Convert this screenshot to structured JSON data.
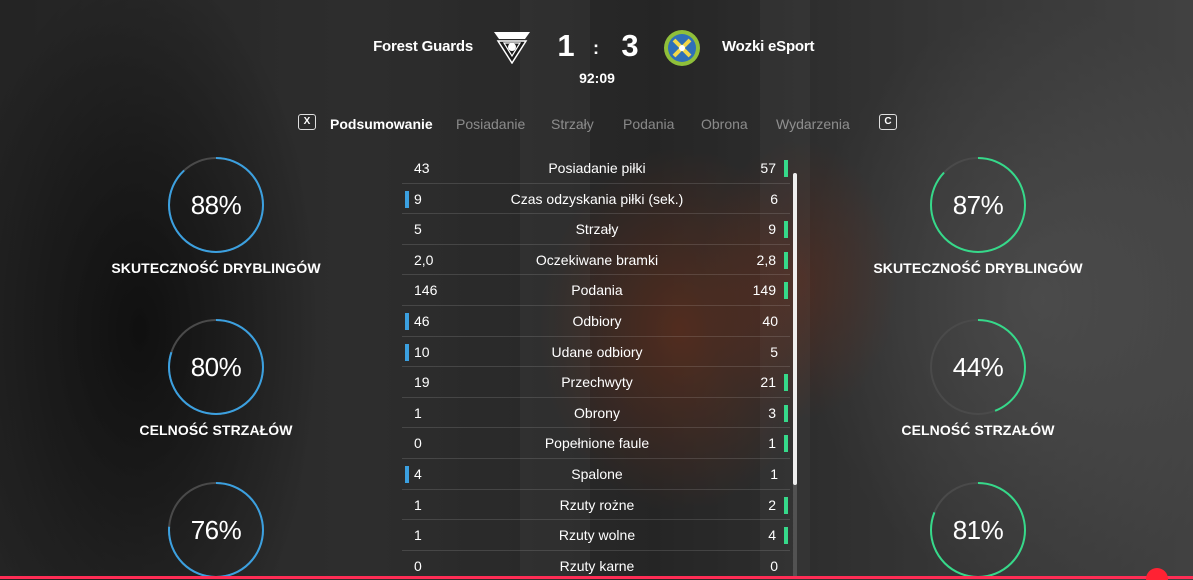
{
  "match": {
    "home_team": "Forest Guards",
    "away_team": "Wozki eSport",
    "home_score": "1",
    "separator": ":",
    "away_score": "3",
    "clock": "92:09",
    "home_crest_icon": "shield-wings-crest-icon",
    "away_crest_icon": "laurel-cross-crest-icon"
  },
  "tabs": {
    "prev_key": "X",
    "next_key": "C",
    "items": [
      {
        "label": "Podsumowanie",
        "active": true
      },
      {
        "label": "Posiadanie",
        "active": false
      },
      {
        "label": "Strzały",
        "active": false
      },
      {
        "label": "Podania",
        "active": false
      },
      {
        "label": "Obrona",
        "active": false
      },
      {
        "label": "Wydarzenia",
        "active": false
      }
    ]
  },
  "colors": {
    "home_accent": "#3ba0e0",
    "away_accent": "#36d98a",
    "ring_track": "#4a4a4a",
    "alert": "#ff2d55"
  },
  "home_rings": [
    {
      "value": "88%",
      "fraction": 0.88,
      "label": "SKUTECZNOŚĆ DRYBLINGÓW"
    },
    {
      "value": "80%",
      "fraction": 0.8,
      "label": "CELNOŚĆ STRZAŁÓW"
    },
    {
      "value": "76%",
      "fraction": 0.76,
      "label": ""
    }
  ],
  "away_rings": [
    {
      "value": "87%",
      "fraction": 0.87,
      "label": "SKUTECZNOŚĆ DRYBLINGÓW"
    },
    {
      "value": "44%",
      "fraction": 0.44,
      "label": "CELNOŚĆ STRZAŁÓW"
    },
    {
      "value": "81%",
      "fraction": 0.81,
      "label": ""
    }
  ],
  "stats": [
    {
      "home": "43",
      "name": "Posiadanie piłki",
      "away": "57",
      "leader": "away"
    },
    {
      "home": "9",
      "name": "Czas odzyskania piłki (sek.)",
      "away": "6",
      "leader": "home"
    },
    {
      "home": "5",
      "name": "Strzały",
      "away": "9",
      "leader": "away"
    },
    {
      "home": "2,0",
      "name": "Oczekiwane bramki",
      "away": "2,8",
      "leader": "away"
    },
    {
      "home": "146",
      "name": "Podania",
      "away": "149",
      "leader": "away"
    },
    {
      "home": "46",
      "name": "Odbiory",
      "away": "40",
      "leader": "home"
    },
    {
      "home": "10",
      "name": "Udane odbiory",
      "away": "5",
      "leader": "home"
    },
    {
      "home": "19",
      "name": "Przechwyty",
      "away": "21",
      "leader": "away"
    },
    {
      "home": "1",
      "name": "Obrony",
      "away": "3",
      "leader": "away"
    },
    {
      "home": "0",
      "name": "Popełnione faule",
      "away": "1",
      "leader": "away"
    },
    {
      "home": "4",
      "name": "Spalone",
      "away": "1",
      "leader": "home"
    },
    {
      "home": "1",
      "name": "Rzuty rożne",
      "away": "2",
      "leader": "away"
    },
    {
      "home": "1",
      "name": "Rzuty wolne",
      "away": "4",
      "leader": "away"
    },
    {
      "home": "0",
      "name": "Rzuty karne",
      "away": "0",
      "leader": "none"
    }
  ]
}
